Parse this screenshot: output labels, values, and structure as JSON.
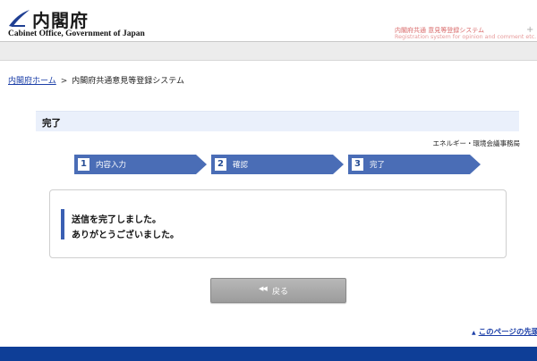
{
  "header": {
    "logo_name": "内閣府",
    "logo_sub": "Cabinet Office, Government of Japan",
    "system_title": "内閣府共通 意見等登録システム",
    "system_subtitle": "Registration system for opinion and comment etc."
  },
  "breadcrumb": {
    "home": "内閣府ホーム",
    "separator": ">",
    "current": "内閣府共通意見等登録システム"
  },
  "page": {
    "title": "完了",
    "office": "エネルギー・環境会議事務局"
  },
  "steps": [
    {
      "num": "1",
      "label": "内容入力"
    },
    {
      "num": "2",
      "label": "確認"
    },
    {
      "num": "3",
      "label": "完了"
    }
  ],
  "message": {
    "line1": "送信を完了しました。",
    "line2": "ありがとうございました。"
  },
  "back_button": {
    "icon": "◀◀",
    "label": "戻る"
  },
  "to_top": {
    "icon": "▲",
    "label": "このページの先頭"
  },
  "colors": {
    "accent": "#3a5fb3",
    "step_fill": "#4a6db6",
    "footer": "#0e3e97",
    "title_bg": "#eaf0fb"
  }
}
